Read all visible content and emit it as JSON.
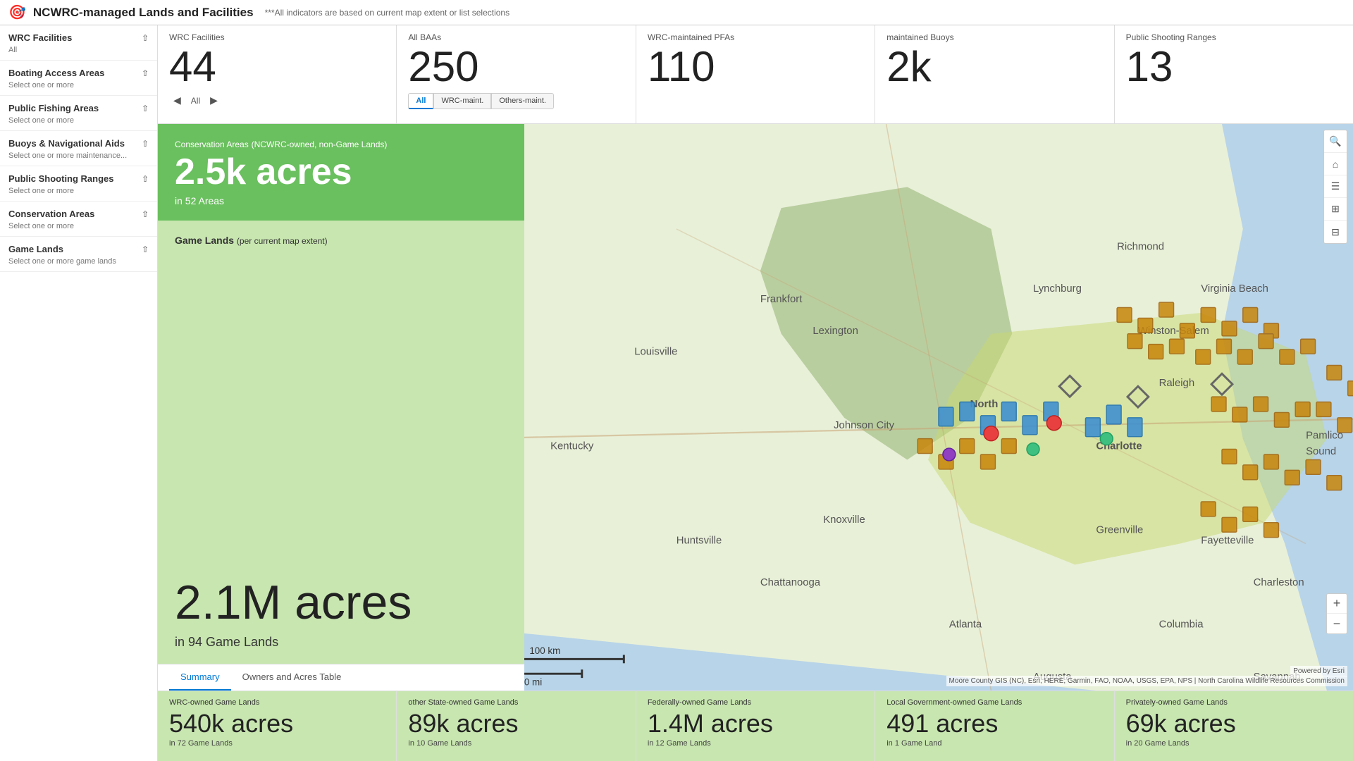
{
  "header": {
    "icon": "🎯",
    "title": "NCWRC-managed Lands and Facilities",
    "subtitle": "***All indicators are based on current map extent or list selections"
  },
  "sidebar": {
    "sections": [
      {
        "id": "wrc-facilities",
        "title": "WRC Facilities",
        "subtitle": "All",
        "expanded": true
      },
      {
        "id": "boating-access",
        "title": "Boating Access Areas",
        "subtitle": "Select one or more",
        "expanded": true
      },
      {
        "id": "public-fishing",
        "title": "Public Fishing Areas",
        "subtitle": "Select one or more",
        "expanded": true
      },
      {
        "id": "buoys-nav",
        "title": "Buoys & Navigational Aids",
        "subtitle": "Select one or more maintenance...",
        "expanded": true
      },
      {
        "id": "public-shooting",
        "title": "Public Shooting Ranges",
        "subtitle": "Select one or more",
        "expanded": true
      },
      {
        "id": "conservation-areas",
        "title": "Conservation Areas",
        "subtitle": "Select one or more",
        "expanded": true
      },
      {
        "id": "game-lands",
        "title": "Game Lands",
        "subtitle": "Select one or more game lands",
        "expanded": true
      }
    ]
  },
  "stats_bar": {
    "cards": [
      {
        "id": "wrc-facilities",
        "label": "WRC Facilities",
        "value": "44",
        "nav": true,
        "nav_label": "All",
        "has_tabs": false
      },
      {
        "id": "all-baas",
        "label": "All BAAs",
        "value": "250",
        "nav": false,
        "has_tabs": true,
        "tabs": [
          "All",
          "WRC-maint.",
          "Others-maint."
        ],
        "active_tab": "All"
      },
      {
        "id": "wrc-pfas",
        "label": "WRC-maintained PFAs",
        "value": "110",
        "nav": false,
        "has_tabs": false
      },
      {
        "id": "maintained-buoys",
        "label": "maintained Buoys",
        "value": "2k",
        "nav": false,
        "has_tabs": false
      },
      {
        "id": "public-shooting-ranges",
        "label": "Public Shooting Ranges",
        "value": "13",
        "nav": false,
        "has_tabs": false
      }
    ]
  },
  "conservation_box": {
    "title": "Conservation Areas",
    "title_suffix": "(NCWRC-owned, non-Game Lands)",
    "value": "2.5k acres",
    "subtitle": "in 52 Areas"
  },
  "game_lands_box": {
    "title": "Game Lands",
    "title_suffix": "(per current map extent)",
    "value": "2.1M acres",
    "subtitle": "in 94 Game Lands"
  },
  "panel_tabs": {
    "tabs": [
      "Summary",
      "Owners and Acres Table"
    ],
    "active": "Summary"
  },
  "map": {
    "attribution": "Moore County GIS (NC), Esri, HERE, Garmin, FAO, NOAA, USGS, EPA, NPS | North Carolina Wildlife Resources Commission",
    "powered_by": "Powered by Esri"
  },
  "map_toolbar": {
    "buttons": [
      "🔍",
      "🏠",
      "☰",
      "⊞",
      "⊟"
    ]
  },
  "bottom_stats": {
    "cards": [
      {
        "id": "wrc-owned",
        "label": "WRC-owned Game Lands",
        "value": "540k acres",
        "subtitle": "in 72 Game Lands"
      },
      {
        "id": "other-state",
        "label": "other State-owned Game Lands",
        "value": "89k acres",
        "subtitle": "in 10 Game Lands"
      },
      {
        "id": "federally-owned",
        "label": "Federally-owned Game Lands",
        "value": "1.4M acres",
        "subtitle": "in 12 Game Lands"
      },
      {
        "id": "local-govt",
        "label": "Local Government-owned Game Lands",
        "value": "491 acres",
        "subtitle": "in 1 Game Land"
      },
      {
        "id": "privately-owned",
        "label": "Privately-owned Game Lands",
        "value": "69k acres",
        "subtitle": "in 20 Game Lands"
      }
    ]
  }
}
